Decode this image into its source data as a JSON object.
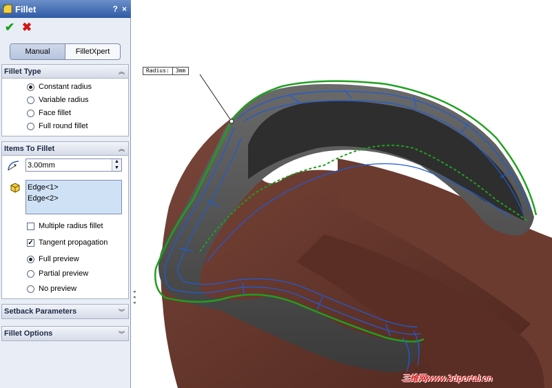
{
  "panel": {
    "title": "Fillet",
    "help_icon": "?",
    "close_icon": "×",
    "ok_label": "✔",
    "cancel_label": "✖",
    "tabs": [
      "Manual",
      "FilletXpert"
    ]
  },
  "fillet_type": {
    "header": "Fillet Type",
    "options": [
      "Constant radius",
      "Variable radius",
      "Face fillet",
      "Full round fillet"
    ],
    "selected": "Constant radius"
  },
  "items": {
    "header": "Items To Fillet",
    "radius_value": "3.00mm",
    "edges": [
      "Edge<1>",
      "Edge<2>"
    ],
    "multiple_radius_label": "Multiple radius fillet",
    "multiple_radius_checked": false,
    "tangent_label": "Tangent propagation",
    "tangent_checked": true,
    "preview_options": [
      "Full preview",
      "Partial preview",
      "No preview"
    ],
    "preview_selected": "Full preview"
  },
  "setback": {
    "header": "Setback Parameters"
  },
  "options": {
    "header": "Fillet Options"
  },
  "viewport": {
    "callout_label": "Radius:",
    "callout_value": "3mm",
    "watermark": "三维网www.3dportal.cn"
  },
  "colors": {
    "accent": "#2f5aa6",
    "model": "#6a3a2e",
    "edge_highlight": "#1ea01e",
    "edge_wire": "#1e5cd0"
  }
}
